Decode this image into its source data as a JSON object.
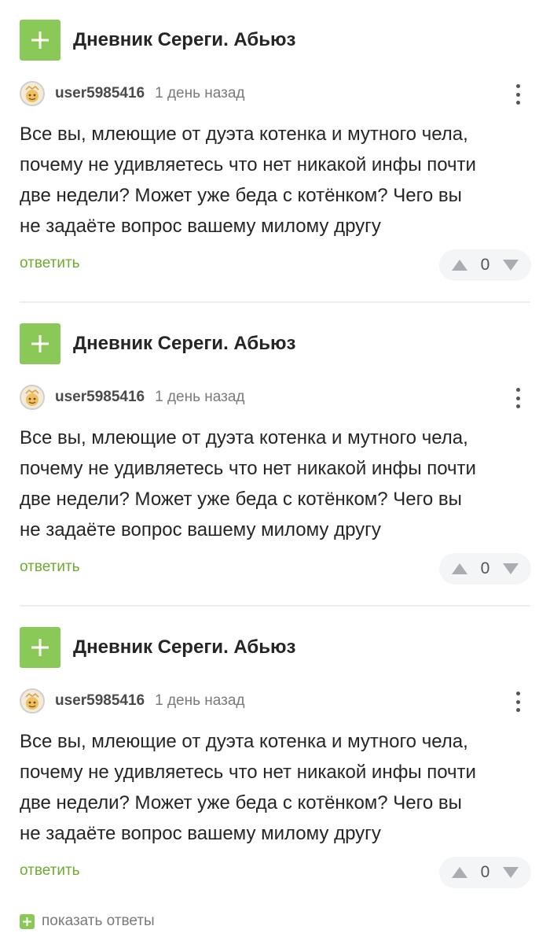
{
  "comments": [
    {
      "story_title": "Дневник Сереги. Абьюз",
      "username": "user5985416",
      "timestamp": "1 день назад",
      "text_lines": [
        "Все вы, млеющие от дуэта котенка и мутного чела,",
        "почему не удивляетесь что нет никакой инфы почти",
        "две недели? Может уже беда с котёнком? Чего вы",
        "не задаёте вопрос вашему милому другу"
      ],
      "reply_label": "ответить",
      "rating": "0"
    },
    {
      "story_title": "Дневник Сереги. Абьюз",
      "username": "user5985416",
      "timestamp": "1 день назад",
      "text_lines": [
        "Все вы, млеющие от дуэта котенка и мутного чела,",
        "почему не удивляетесь что нет никакой инфы почти",
        "две недели? Может уже беда с котёнком? Чего вы",
        "не задаёте вопрос вашему милому другу"
      ],
      "reply_label": "ответить",
      "rating": "0"
    },
    {
      "story_title": "Дневник Сереги. Абьюз",
      "username": "user5985416",
      "timestamp": "1 день назад",
      "text_lines": [
        "Все вы, млеющие от дуэта котенка и мутного чела,",
        "почему не удивляетесь что нет никакой инфы почти",
        "две недели? Может уже беда с котёнком? Чего вы",
        "не задаёте вопрос вашему милому другу"
      ],
      "reply_label": "ответить",
      "rating": "0"
    }
  ],
  "show_replies_label": "показать ответы",
  "icons": {
    "add": "plus-icon",
    "avatar": "avatar-image",
    "more": "more-vertical-icon",
    "upvote": "arrow-up-icon",
    "downvote": "arrow-down-icon"
  },
  "colors": {
    "accent_green": "#8ac858",
    "reply_link_green": "#6cab2f",
    "text_primary": "#252525",
    "text_secondary": "#7a7a7a",
    "rating_bg": "#f3f5f7",
    "divider": "#eeeeee"
  }
}
